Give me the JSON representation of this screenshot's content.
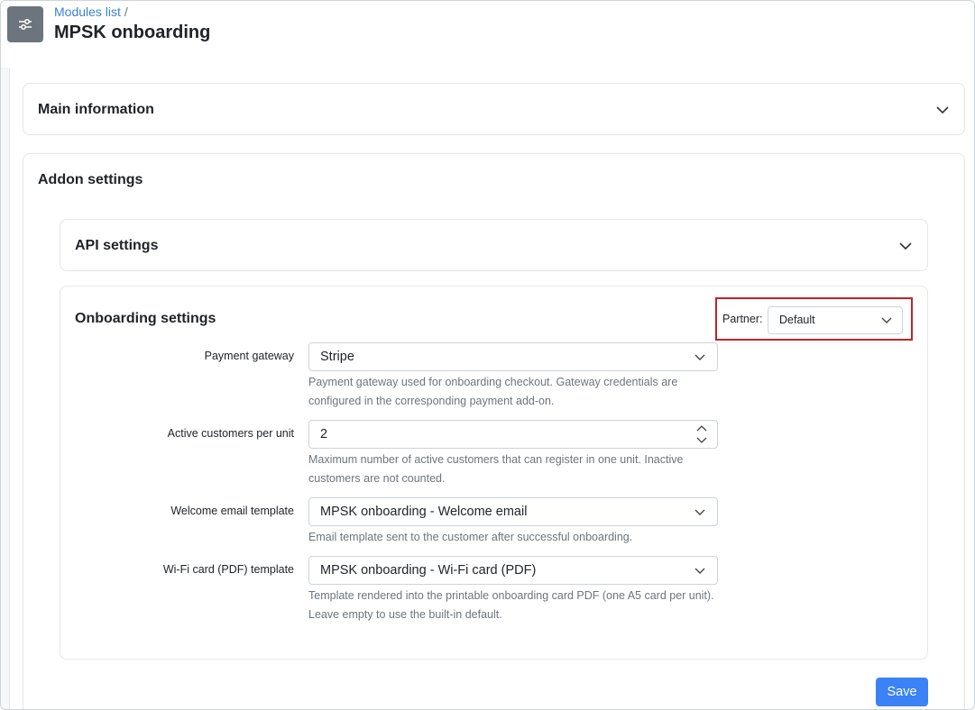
{
  "header": {
    "breadcrumb_link": "Modules list",
    "breadcrumb_sep": "/",
    "title": "MPSK onboarding",
    "icon": "sliders-icon"
  },
  "sections": {
    "main_information": "Main information",
    "addon_settings": "Addon settings",
    "api_settings": "API settings",
    "onboarding_settings": "Onboarding settings"
  },
  "partner": {
    "label": "Partner:",
    "value": "Default"
  },
  "form": {
    "payment_gateway": {
      "label": "Payment gateway",
      "value": "Stripe",
      "help": "Payment gateway used for onboarding checkout. Gateway credentials are configured in the corresponding payment add-on."
    },
    "active_customers": {
      "label": "Active customers per unit",
      "value": "2",
      "help": "Maximum number of active customers that can register in one unit. Inactive customers are not counted."
    },
    "welcome_email": {
      "label": "Welcome email template",
      "value": "MPSK onboarding - Welcome email",
      "help": "Email template sent to the customer after successful onboarding."
    },
    "wifi_card": {
      "label": "Wi-Fi card (PDF) template",
      "value": "MPSK onboarding - Wi-Fi card (PDF)",
      "help": "Template rendered into the printable onboarding card PDF (one A5 card per unit). Leave empty to use the built-in default."
    }
  },
  "actions": {
    "save": "Save"
  },
  "colors": {
    "accent": "#3b82f6",
    "highlight": "#c0222c",
    "link": "#3b82d6"
  }
}
